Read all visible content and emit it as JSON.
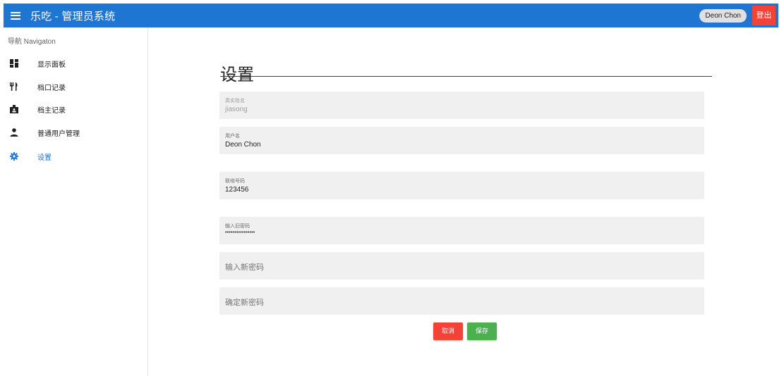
{
  "appbar": {
    "title": "乐吃 - 管理员系统",
    "user_name": "Deon Chon",
    "logout_label": "登出",
    "color": "#1e76d3"
  },
  "sidebar": {
    "header": "导航 Navigaton",
    "items": [
      {
        "label": "显示面板",
        "icon": "dashboard-icon"
      },
      {
        "label": "档口记录",
        "icon": "restaurant-icon"
      },
      {
        "label": "档主记录",
        "icon": "badge-icon"
      },
      {
        "label": "普通用户管理",
        "icon": "person-icon"
      },
      {
        "label": "设置",
        "icon": "gear-icon",
        "active": true
      }
    ]
  },
  "main": {
    "title": "设置",
    "fields": {
      "real_name": {
        "label": "真实姓名",
        "value": "jiasong"
      },
      "username": {
        "label": "用户名",
        "value": "Deon Chon"
      },
      "phone": {
        "label": "联络号码",
        "value": "123456"
      },
      "old_password": {
        "label": "输入旧密码",
        "value": "••••••••••••••••"
      },
      "new_password": {
        "placeholder": "输入新密码"
      },
      "confirm_password": {
        "placeholder": "确定新密码"
      }
    },
    "cancel_label": "取消",
    "save_label": "保存"
  }
}
